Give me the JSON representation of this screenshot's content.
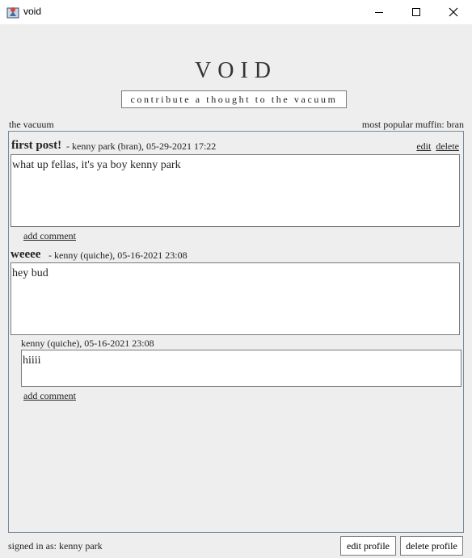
{
  "window": {
    "title": "void",
    "icon": "app-icon"
  },
  "header": {
    "brand": "VOID",
    "contribute_label": "contribute a thought to the vacuum"
  },
  "feed_header": {
    "left": "the vacuum",
    "right": "most popular muffin: bran"
  },
  "posts": [
    {
      "title": "first post!",
      "meta": "kenny park (bran), 05-29-2021 17:22",
      "body": "what up fellas, it's ya boy kenny park",
      "edit_label": "edit",
      "delete_label": "delete",
      "add_comment": "add comment"
    },
    {
      "title": "weeee",
      "meta": "kenny (quiche), 05-16-2021 23:08",
      "body": "hey bud",
      "comments": [
        {
          "meta": "kenny (quiche), 05-16-2021 23:08",
          "body": "hiiii"
        }
      ],
      "add_comment": "add comment"
    }
  ],
  "footer": {
    "signed_in": "signed in as: kenny park",
    "edit_profile": "edit profile",
    "delete_profile": "delete profile"
  }
}
